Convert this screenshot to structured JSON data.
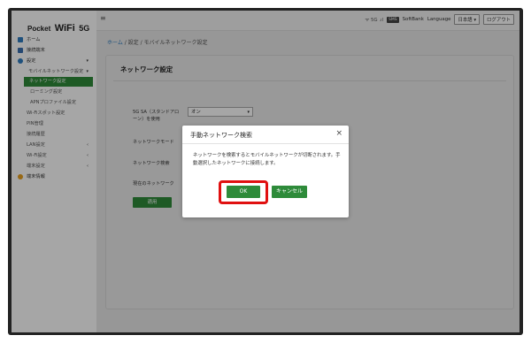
{
  "app": {
    "logo_pocket": "Pocket",
    "logo_wifi": "WiFi",
    "logo_5g": "5G"
  },
  "header": {
    "menu_icon": "≡",
    "signal_icons": "ᯤ 5G .ıl",
    "badge": "SMS",
    "carrier": "SoftBank",
    "language_label": "Language",
    "language_value": "日本語 ▾",
    "logout": "ログアウト"
  },
  "sidebar": {
    "items": [
      {
        "label": "ホーム",
        "icon": "home-icon",
        "caret": ""
      },
      {
        "label": "接続端末",
        "icon": "devices-icon",
        "caret": ""
      },
      {
        "label": "設定",
        "icon": "settings-icon",
        "caret": "▾"
      },
      {
        "label": "モバイルネットワーク設定",
        "caret": "▾"
      },
      {
        "label": "ネットワーク設定"
      },
      {
        "label": "ローミング設定"
      },
      {
        "label": "APNプロファイル設定"
      },
      {
        "label": "Wi-Fiスポット設定"
      },
      {
        "label": "PIN管理"
      },
      {
        "label": "接続履歴"
      },
      {
        "label": "LAN設定",
        "caret": "‹"
      },
      {
        "label": "Wi-Fi設定",
        "caret": "‹"
      },
      {
        "label": "端末設定",
        "caret": "‹"
      },
      {
        "label": "端末情報",
        "icon": "info-icon"
      }
    ]
  },
  "breadcrumb": {
    "home": "ホーム",
    "rest": " / 設定 / モバイルネットワーク設定"
  },
  "main": {
    "title": "ネットワーク設定",
    "field1_label_a": "5G SA（スタンドアロ",
    "field1_label_b": "ーン）を使用",
    "field1_value": "オン",
    "field2_label": "ネットワークモード",
    "field3_label": "ネットワーク検索",
    "field4_label": "現在のネットワーク",
    "apply": "適用"
  },
  "dialog": {
    "title": "手動ネットワーク検索",
    "close": "×",
    "message": "ネットワークを検索するとモバイルネットワークが切断されます。手動選択したネットワークに接続します。",
    "ok": "OK",
    "cancel": "キャンセル"
  },
  "colors": {
    "accent_green": "#2e8b3a",
    "highlight_red": "#e01010",
    "link_blue": "#2e7bbf"
  }
}
